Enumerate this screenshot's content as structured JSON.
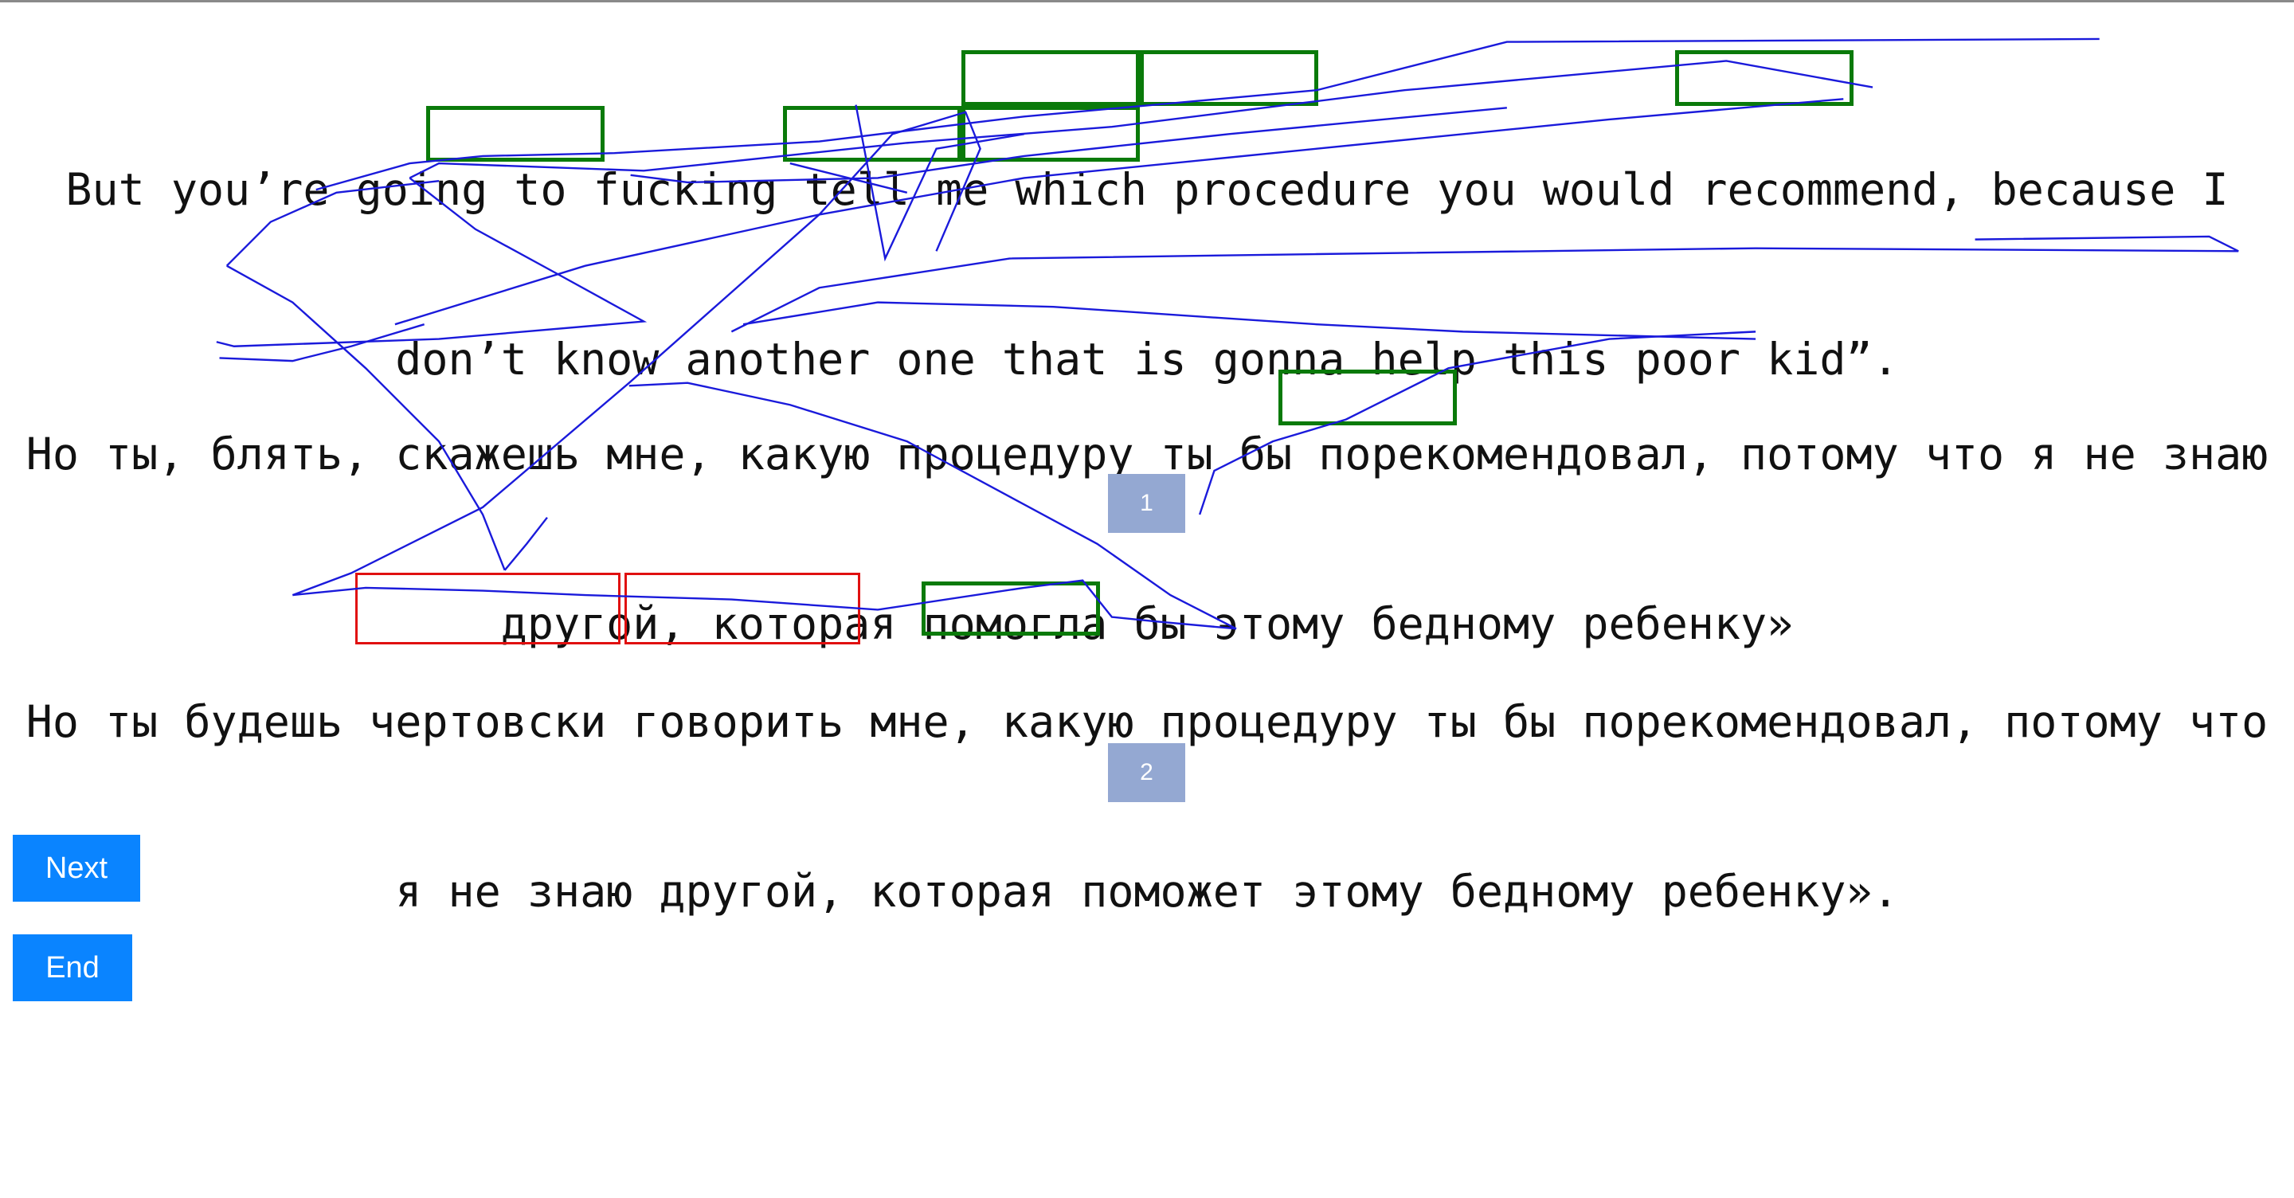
{
  "source": {
    "lines": [
      "But you’re going to fucking tell me which procedure you would recommend, because I",
      "don’t know another one that is gonna help this poor kid”."
    ]
  },
  "translation_1": {
    "lines": [
      "Но ты, блять, скажешь мне, какую процедуру ты бы порекомендовал, потому что я не знаю",
      "другой, которая помогла бы этому бедному ребенку»"
    ],
    "index": "1"
  },
  "translation_2": {
    "lines": [
      "Но ты будешь чертовски говорить мне, какую процедуру ты бы порекомендовал, потому что",
      "я не знаю другой, которая поможет этому бедному ребенку»."
    ],
    "index": "2"
  },
  "buttons": {
    "next": "Next",
    "end": "End"
  },
  "colors": {
    "match_box": "#0a7a0a",
    "error_box": "#e01010",
    "scribble": "#1a1adb",
    "button": "#0a84ff",
    "index_badge": "#94a8d2"
  }
}
